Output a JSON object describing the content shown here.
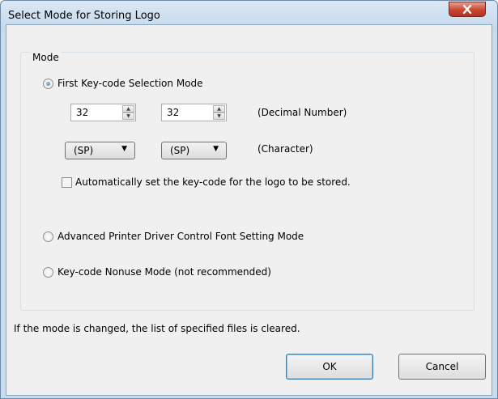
{
  "window": {
    "title": "Select Mode for Storing Logo",
    "close_icon": "close-icon"
  },
  "group": {
    "label": "Mode",
    "first_mode": {
      "label": "First Key-code Selection Mode",
      "spin1_value": "32",
      "spin2_value": "32",
      "decimal_caption": "(Decimal Number)",
      "combo1_value": "(SP)",
      "combo2_value": "(SP)",
      "character_caption": "(Character)",
      "auto_checkbox_label": "Automatically set the key-code for the logo to be stored.",
      "auto_checked": false
    },
    "advanced_mode": {
      "label": "Advanced Printer Driver Control Font Setting Mode"
    },
    "nonuse_mode": {
      "label": "Key-code Nonuse Mode (not recommended)"
    },
    "selected_mode": "first"
  },
  "note": "If the mode is changed, the list of specified files is cleared.",
  "buttons": {
    "ok": "OK",
    "cancel": "Cancel"
  },
  "colors": {
    "accent": "#3c7fb1",
    "close": "#c9452f",
    "frame": "#c9dcee"
  }
}
